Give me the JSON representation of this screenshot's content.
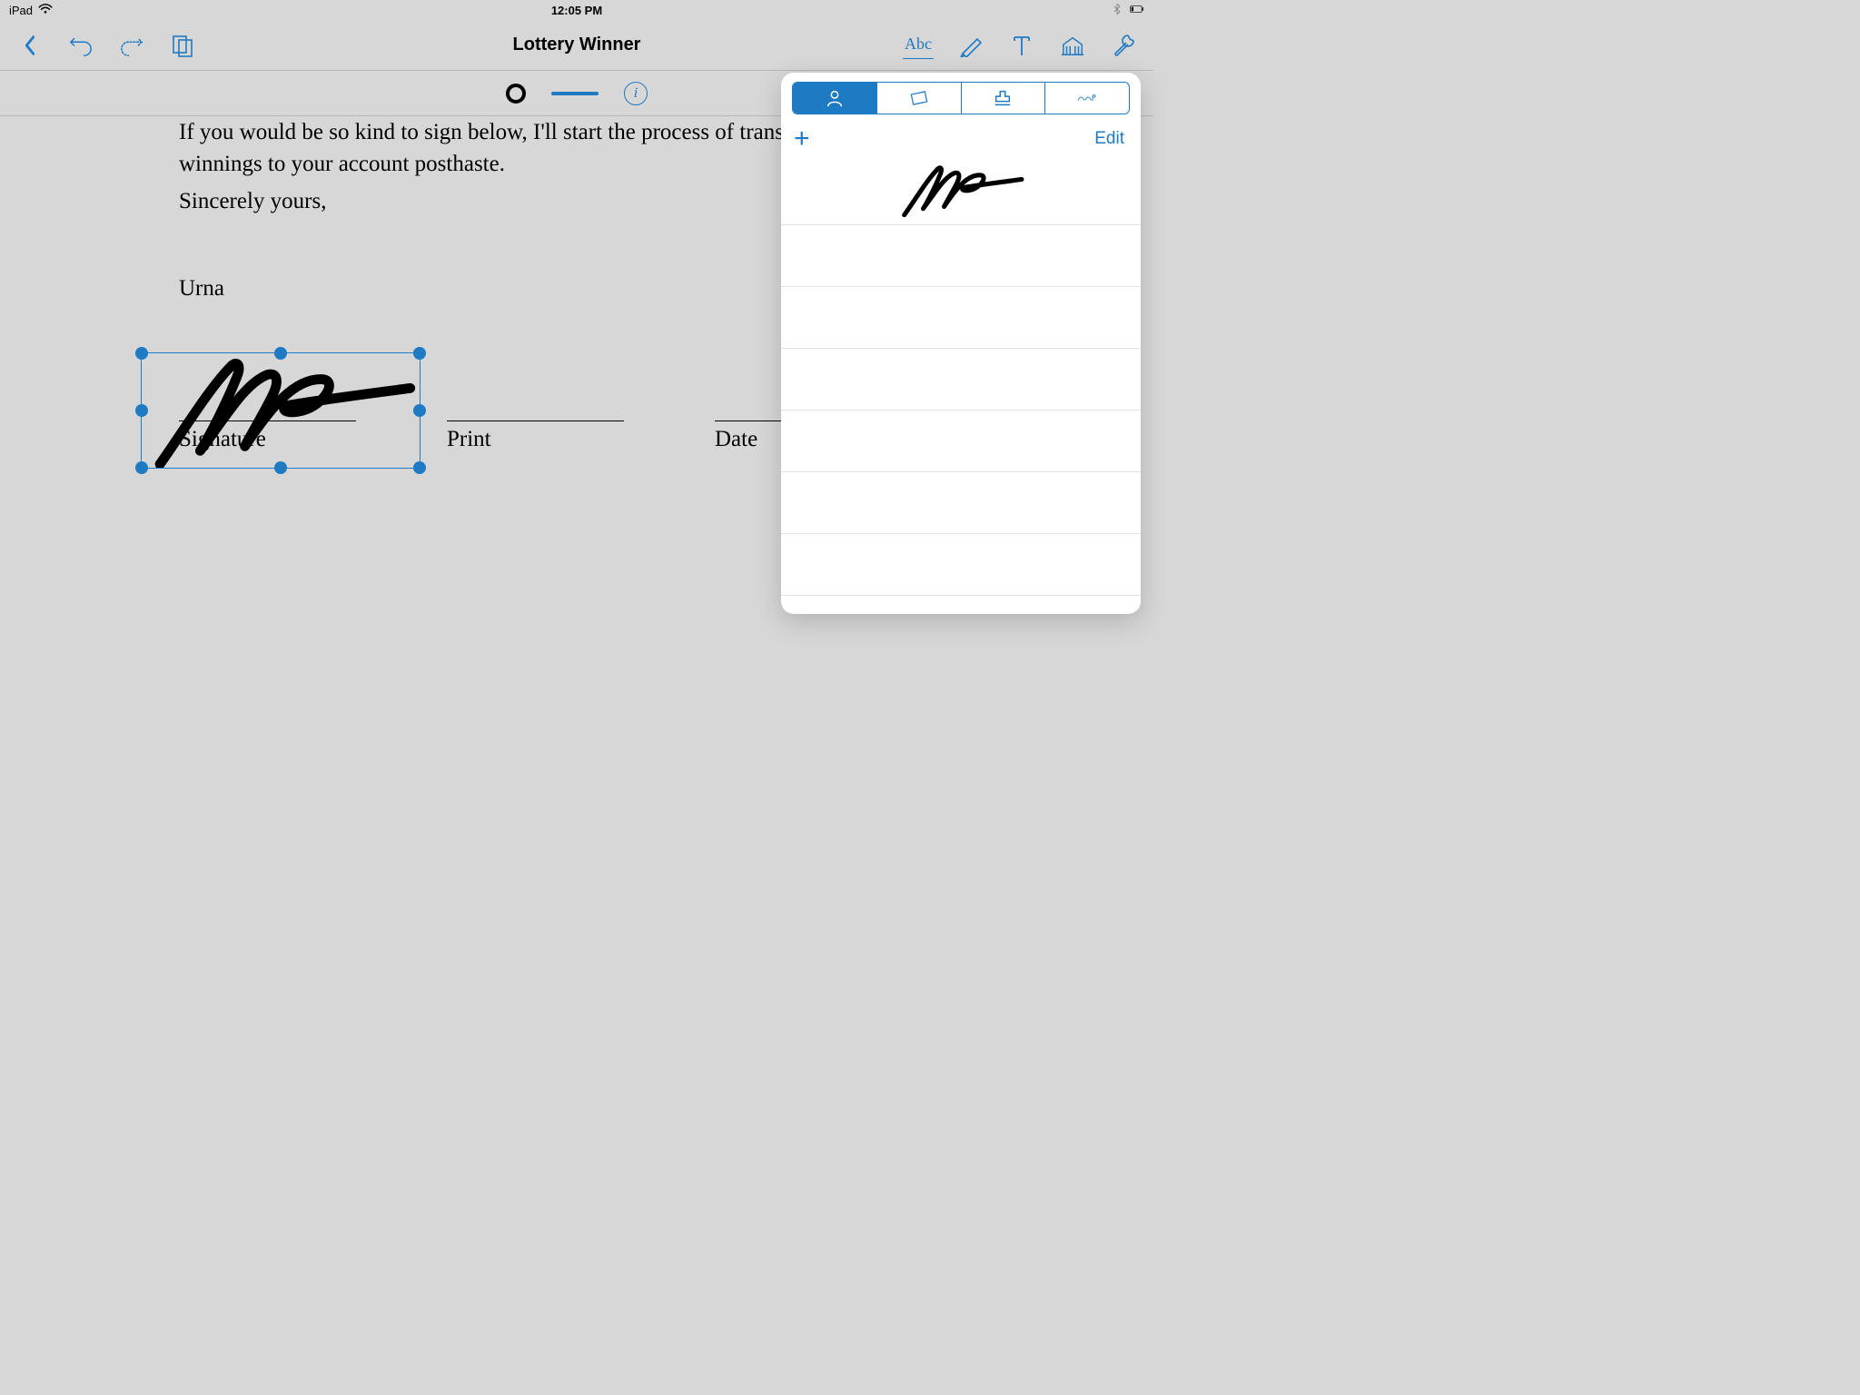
{
  "status_bar": {
    "device": "iPad",
    "time": "12:05 PM"
  },
  "toolbar": {
    "title": "Lottery Winner",
    "abc_label": "Abc"
  },
  "document": {
    "paragraph_line1": "If you would be so kind to sign below, I'll start the process of transfe",
    "paragraph_line2": "winnings to your account posthaste.",
    "closing": "Sincerely yours,",
    "sender": "Urna",
    "signature_label": "Signature",
    "print_label": "Print",
    "date_label": "Date"
  },
  "popover": {
    "add_label": "+",
    "edit_label": "Edit"
  }
}
